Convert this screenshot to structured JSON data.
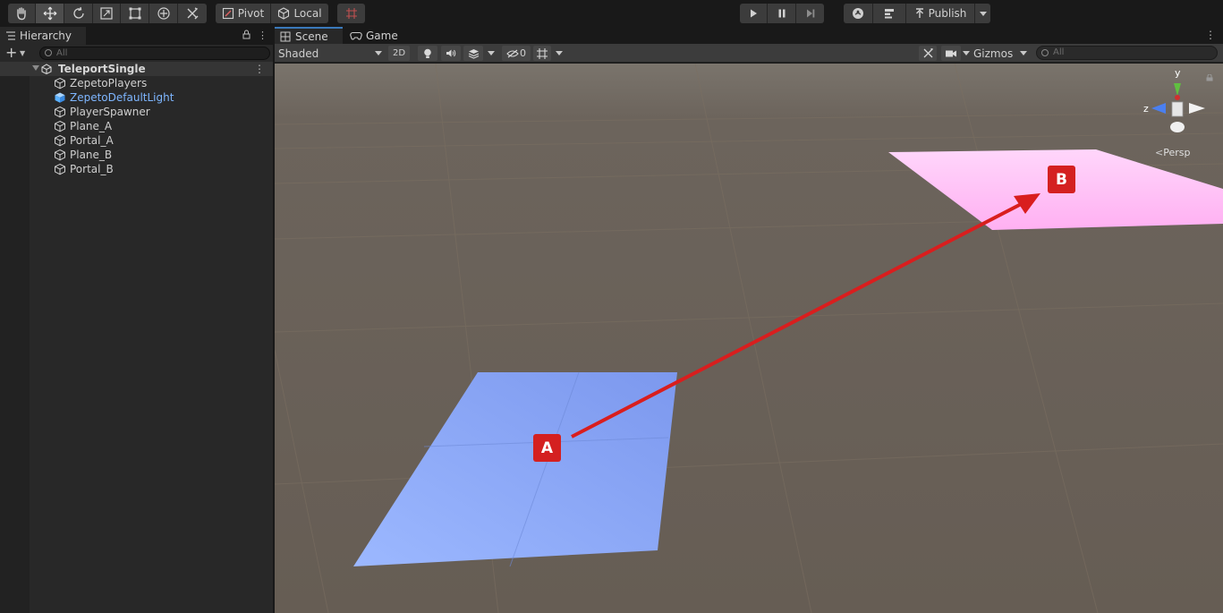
{
  "toolbar": {
    "tools": [
      "hand-tool",
      "move-tool",
      "rotate-tool",
      "scale-tool",
      "rect-tool",
      "transform-tool",
      "custom-tool"
    ],
    "pivot_label": "Pivot",
    "local_label": "Local",
    "publish_label": "Publish"
  },
  "hierarchy": {
    "tab_label": "Hierarchy",
    "search_placeholder": "All",
    "scene_name": "TeleportSingle",
    "items": [
      {
        "label": "ZepetoPlayers",
        "icon": "cube-icon"
      },
      {
        "label": "ZepetoDefaultLight",
        "icon": "cube-blue-icon"
      },
      {
        "label": "PlayerSpawner",
        "icon": "cube-icon"
      },
      {
        "label": "Plane_A",
        "icon": "cube-icon"
      },
      {
        "label": "Portal_A",
        "icon": "cube-icon"
      },
      {
        "label": "Plane_B",
        "icon": "cube-icon"
      },
      {
        "label": "Portal_B",
        "icon": "cube-icon"
      }
    ]
  },
  "scene": {
    "tabs": [
      {
        "label": "Scene",
        "active": true
      },
      {
        "label": "Game",
        "active": false
      }
    ],
    "shading_mode": "Shaded",
    "two_d_label": "2D",
    "hidden_count": "0",
    "gizmos_label": "Gizmos",
    "search_placeholder": "All",
    "projection_label": "Persp",
    "axis_labels": {
      "y": "y",
      "z": "z"
    },
    "marker_a": "A",
    "marker_b": "B"
  },
  "colors": {
    "plane_a": "#86a6ff",
    "plane_b": "#ffbef6",
    "arrow": "#d91e1e",
    "ground": "#6a625a",
    "accent_tab": "#3a79bb",
    "selected_item": "#7eb6ff"
  }
}
